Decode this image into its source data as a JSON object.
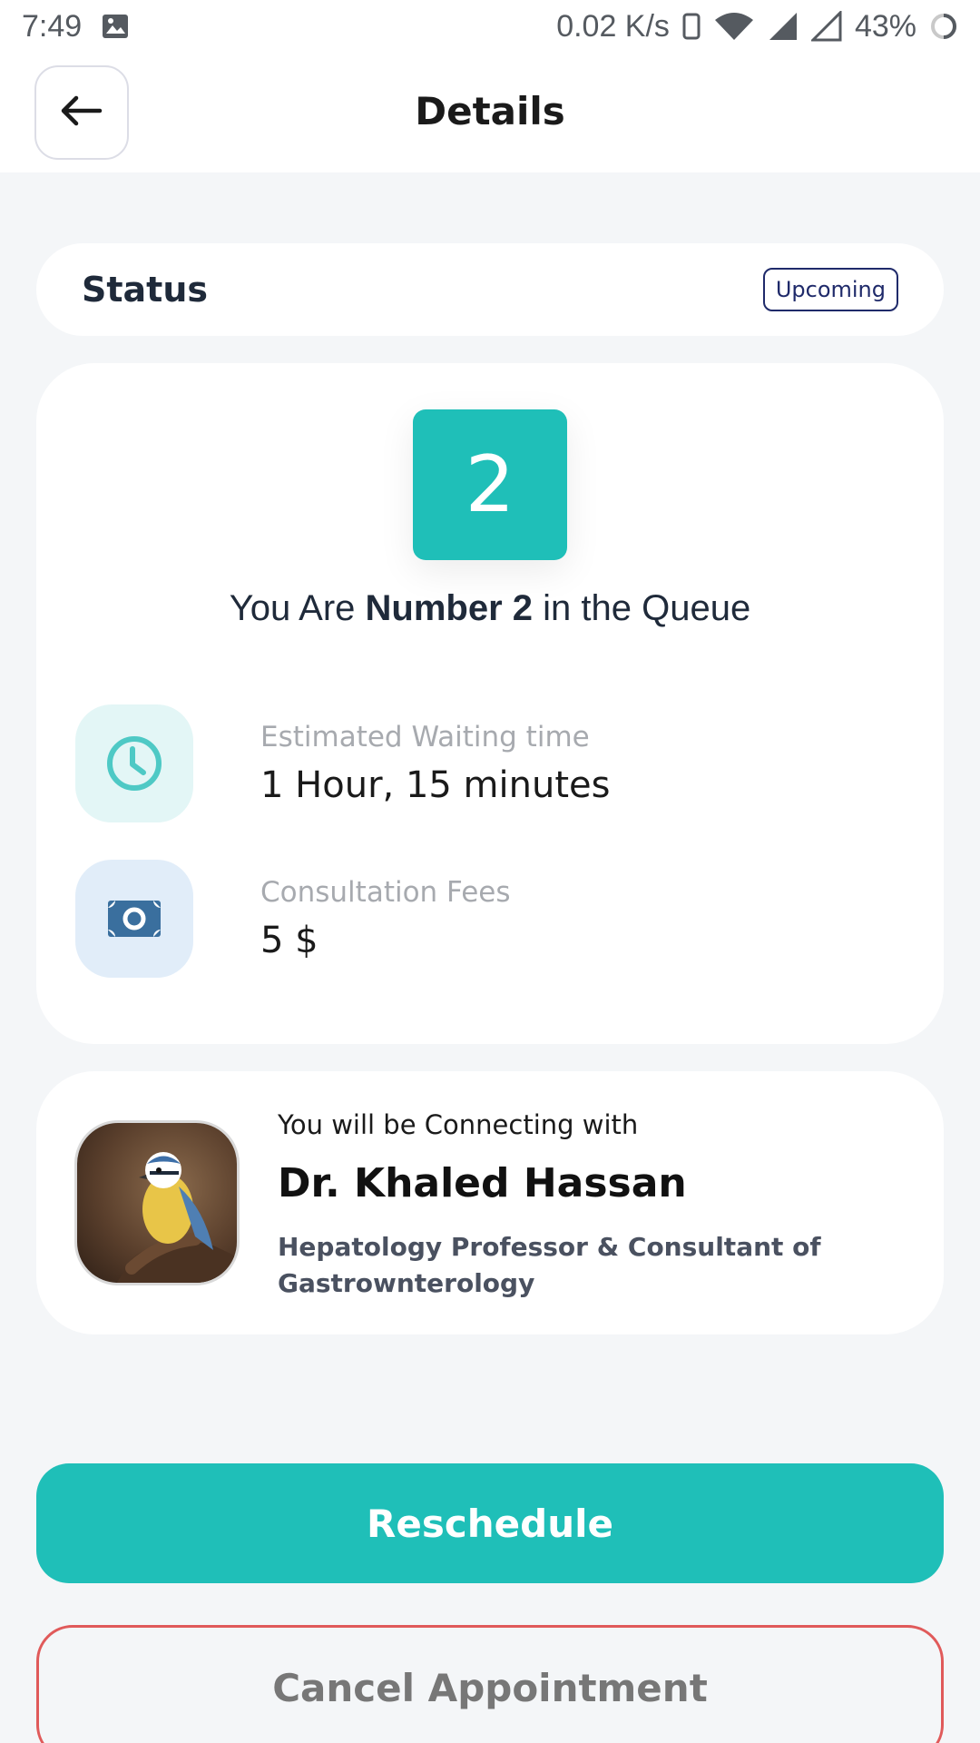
{
  "statusbar": {
    "time": "7:49",
    "network_speed": "0.02 K/s",
    "battery": "43%"
  },
  "header": {
    "title": "Details"
  },
  "status": {
    "label": "Status",
    "badge": "Upcoming"
  },
  "queue": {
    "number": "2",
    "text_prefix": "You Are ",
    "text_bold": "Number 2",
    "text_suffix": " in the Queue"
  },
  "wait": {
    "label": "Estimated Waiting time",
    "value": "1 Hour, 15 minutes",
    "icon": "clock-icon"
  },
  "fees": {
    "label": "Consultation Fees",
    "value": "5 $",
    "icon": "money-icon"
  },
  "doctor": {
    "connect_text": "You will be Connecting with",
    "name": "Dr. Khaled Hassan",
    "title": "Hepatology Professor & Consultant of Gastrownterology"
  },
  "actions": {
    "reschedule": "Reschedule",
    "cancel": "Cancel Appointment"
  },
  "colors": {
    "accent": "#1fbfb8",
    "danger": "#e05a5a",
    "badge": "#1f2a6a"
  }
}
